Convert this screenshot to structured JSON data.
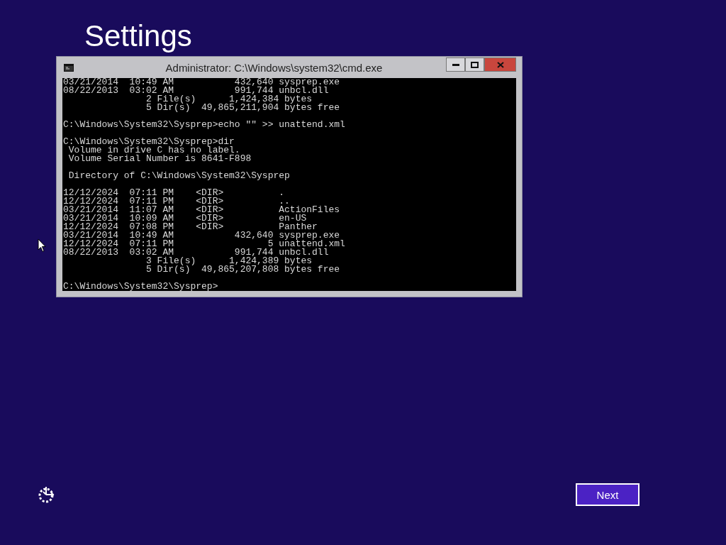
{
  "page": {
    "heading": "Settings"
  },
  "console_window": {
    "title": "Administrator: C:\\Windows\\system32\\cmd.exe",
    "buttons": [
      {
        "kind": "minimize"
      },
      {
        "kind": "maximize"
      },
      {
        "kind": "close"
      }
    ],
    "blocks": [
      [
        "03/21/2014  10:49 AM           432,640 sysprep.exe",
        "08/22/2013  03:02 AM           991,744 unbcl.dll",
        "               2 File(s)      1,424,384 bytes",
        "               5 Dir(s)  49,865,211,904 bytes free"
      ],
      [
        "C:\\Windows\\System32\\Sysprep>echo \"\" >> unattend.xml"
      ],
      [
        "C:\\Windows\\System32\\Sysprep>dir",
        " Volume in drive C has no label.",
        " Volume Serial Number is 8641-F898"
      ],
      [
        " Directory of C:\\Windows\\System32\\Sysprep"
      ],
      [
        "12/12/2024  07:11 PM    <DIR>          .",
        "12/12/2024  07:11 PM    <DIR>          ..",
        "03/21/2014  11:07 AM    <DIR>          ActionFiles",
        "03/21/2014  10:09 AM    <DIR>          en-US",
        "12/12/2024  07:08 PM    <DIR>          Panther",
        "03/21/2014  10:49 AM           432,640 sysprep.exe",
        "12/12/2024  07:11 PM                 5 unattend.xml",
        "08/22/2013  03:02 AM           991,744 unbcl.dll",
        "               3 File(s)      1,424,389 bytes",
        "               5 Dir(s)  49,865,207,808 bytes free"
      ],
      [
        "C:\\Windows\\System32\\Sysprep>"
      ]
    ]
  },
  "footer": {
    "next_button": "Next"
  }
}
